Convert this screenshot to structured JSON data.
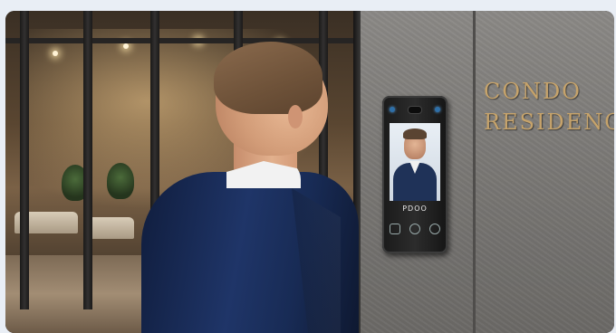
{
  "sign": {
    "line1": "CONDO",
    "line2": "RESIDENCE"
  },
  "terminal": {
    "keypad_text": "PDOO"
  },
  "colors": {
    "suit": "#1f3568",
    "sign_gold": "#c6a36b",
    "wall_stone": "#7a7875",
    "terminal_body": "#1a1a1a"
  }
}
